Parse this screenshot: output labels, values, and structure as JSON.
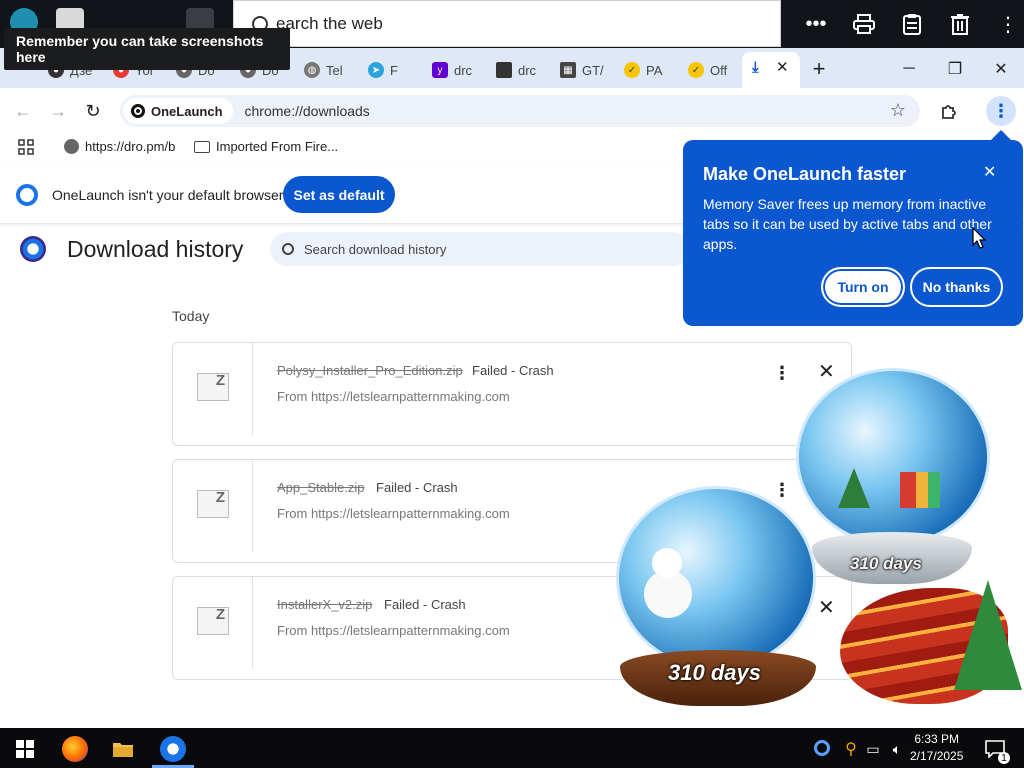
{
  "overlay": {
    "tooltip": "Remember you can take screenshots here",
    "search_text": "earch the web"
  },
  "tabs": [
    {
      "label": "Дзе",
      "icon": "globe"
    },
    {
      "label": "Yor",
      "icon": "red"
    },
    {
      "label": "Do",
      "icon": "gray"
    },
    {
      "label": "Do",
      "icon": "gray"
    },
    {
      "label": "Tel",
      "icon": "globe"
    },
    {
      "label": "F",
      "icon": "telegram"
    },
    {
      "label": "drc",
      "icon": "yahoo"
    },
    {
      "label": "drc",
      "icon": "gtt"
    },
    {
      "label": "GT/",
      "icon": "gtmovie"
    },
    {
      "label": "PA",
      "icon": "check"
    },
    {
      "label": "Off",
      "icon": "check"
    }
  ],
  "address": {
    "site_chip": "OneLaunch",
    "url": "chrome://downloads"
  },
  "bookmarks": [
    {
      "label": "https://dro.pm/b",
      "icon": "globe-icon"
    },
    {
      "label": "Imported From Fire...",
      "icon": "folder-icon"
    }
  ],
  "infobar": {
    "text": "OneLaunch isn't your default browser",
    "button": "Set as default"
  },
  "downloads": {
    "title": "Download history",
    "search_placeholder": "Search download history",
    "group": "Today",
    "items": [
      {
        "name": "Polysy_Installer_Pro_Edition.zip",
        "status": "Failed - Crash",
        "from": "From https://letslearnpatternmaking.com"
      },
      {
        "name": "App_Stable.zip",
        "status": "Failed - Crash",
        "from": "From https://letslearnpatternmaking.com"
      },
      {
        "name": "InstallerX_v2.zip",
        "status": "Failed - Crash",
        "from": "From https://letslearnpatternmaking.com"
      }
    ]
  },
  "promo": {
    "title": "Make OneLaunch faster",
    "body": "Memory Saver frees up memory from inactive tabs so it can be used by active tabs and other apps.",
    "primary": "Turn on",
    "secondary": "No thanks"
  },
  "ads": {
    "globe_left_badge": "310 days",
    "globe_right_badge": "310 days"
  },
  "taskbar": {
    "time": "6:33 PM",
    "date": "2/17/2025",
    "notifications": "1"
  },
  "colors": {
    "accent": "#0b57d0",
    "tabstrip": "#dfe8f7",
    "taskbar": "#0a0a0c"
  }
}
